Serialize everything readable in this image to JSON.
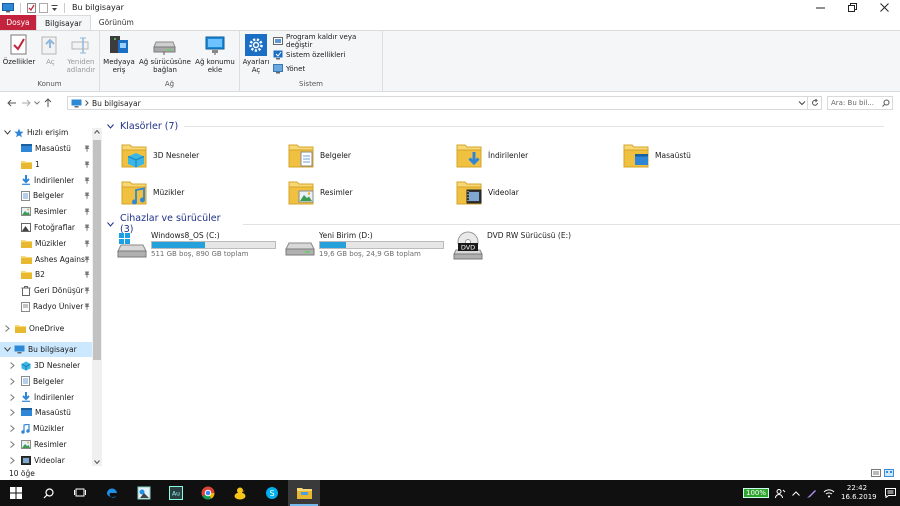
{
  "window": {
    "title": "Bu bilgisayar"
  },
  "ribbon_tabs": [
    {
      "label": "Dosya"
    },
    {
      "label": "Bilgisayar"
    },
    {
      "label": "Görünüm"
    }
  ],
  "ribbon": {
    "konum": {
      "label": "Konum",
      "properties": "Özellikler",
      "open": "Aç",
      "rename_line1": "Yeniden",
      "rename_line2": "adlandır"
    },
    "ag": {
      "label": "Ağ",
      "media_line1": "Medyaya",
      "media_line2": "eriş",
      "map_drive_line1": "Ağ sürücüsüne",
      "map_drive_line2": "bağlan",
      "add_location_line1": "Ağ konumu",
      "add_location_line2": "ekle"
    },
    "sistem": {
      "label": "Sistem",
      "settings_line1": "Ayarları",
      "settings_line2": "Aç",
      "uninstall": "Program kaldır veya değiştir",
      "system_properties": "Sistem özellikleri",
      "manage": "Yönet"
    }
  },
  "address": {
    "crumb": "Bu bilgisayar",
    "search_placeholder": "Ara: Bu bil..."
  },
  "nav": {
    "quick_access": "Hızlı erişim",
    "quick_items": [
      {
        "label": "Masaüstü"
      },
      {
        "label": "1"
      },
      {
        "label": "İndirilenler"
      },
      {
        "label": "Belgeler"
      },
      {
        "label": "Resimler"
      },
      {
        "label": "Fotoğraflar"
      },
      {
        "label": "Müzikler"
      },
      {
        "label": "Ashes Agains"
      },
      {
        "label": "B2"
      },
      {
        "label": "Geri Dönüşür"
      },
      {
        "label": "Radyo Üniver"
      }
    ],
    "onedrive": "OneDrive",
    "this_pc": "Bu bilgisayar",
    "pc_items": [
      {
        "label": "3D Nesneler"
      },
      {
        "label": "Belgeler"
      },
      {
        "label": "İndirilenler"
      },
      {
        "label": "Masaüstü"
      },
      {
        "label": "Müzikler"
      },
      {
        "label": "Resimler"
      },
      {
        "label": "Videolar"
      }
    ]
  },
  "content": {
    "folders_header": "Klasörler (7)",
    "folders": [
      {
        "label": "3D Nesneler",
        "icon": "3d-objects-folder-icon"
      },
      {
        "label": "Belgeler",
        "icon": "documents-folder-icon"
      },
      {
        "label": "İndirilenler",
        "icon": "downloads-folder-icon"
      },
      {
        "label": "Masaüstü",
        "icon": "desktop-folder-icon"
      },
      {
        "label": "Müzikler",
        "icon": "music-folder-icon"
      },
      {
        "label": "Resimler",
        "icon": "pictures-folder-icon"
      },
      {
        "label": "Videolar",
        "icon": "videos-folder-icon"
      }
    ],
    "devices_header": "Cihazlar ve sürücüler (3)",
    "drives": [
      {
        "name": "Windows8_OS (C:)",
        "free_text": "511 GB boş, 890 GB toplam",
        "used_fraction": 0.43
      },
      {
        "name": "Yeni Birim (D:)",
        "free_text": "19,6 GB boş, 24,9 GB toplam",
        "used_fraction": 0.21
      }
    ],
    "dvd": {
      "name": "DVD RW Sürücüsü (E:)",
      "disc_label": "DVD"
    }
  },
  "status": {
    "item_count": "10 öğe"
  },
  "taskbar": {
    "app_label_au": "Au",
    "battery": "100%",
    "time": "22:42",
    "date": "16.6.2019"
  },
  "colors": {
    "accent": "#0078d7",
    "file_tab": "#c4233d",
    "drive_bar": "#26a0da",
    "group_header": "#1e3287",
    "selection": "#cce8ff"
  }
}
